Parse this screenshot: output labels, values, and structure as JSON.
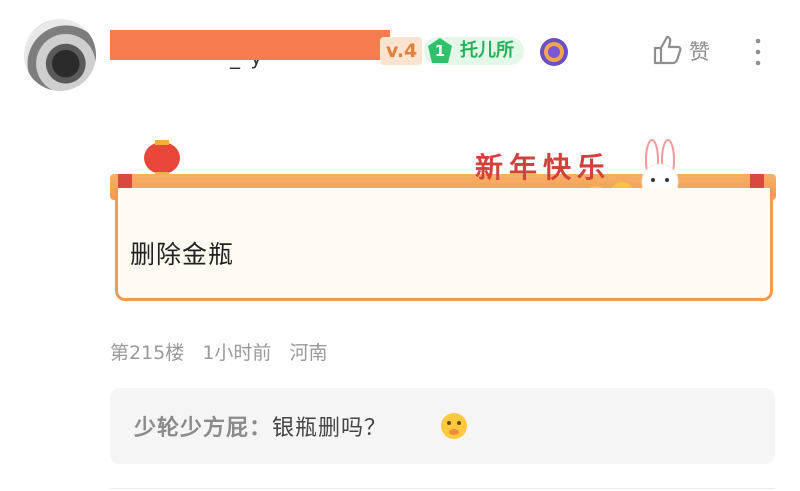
{
  "header": {
    "username_tail": "_      y",
    "level_badge": "v.4",
    "group_badge_level": "1",
    "group_badge_text": "托儿所",
    "like_label": "赞"
  },
  "post": {
    "banner_text": "新年快乐",
    "content": "删除金瓶"
  },
  "meta": {
    "floor": "第215楼",
    "time": "1小时前",
    "location": "河南"
  },
  "reply": {
    "user": "少轮少方屁：",
    "text": "银瓶删吗？"
  },
  "colors": {
    "accent_orange": "#f47c4e",
    "group_green": "#23b35b",
    "banner_red": "#d2413c"
  }
}
